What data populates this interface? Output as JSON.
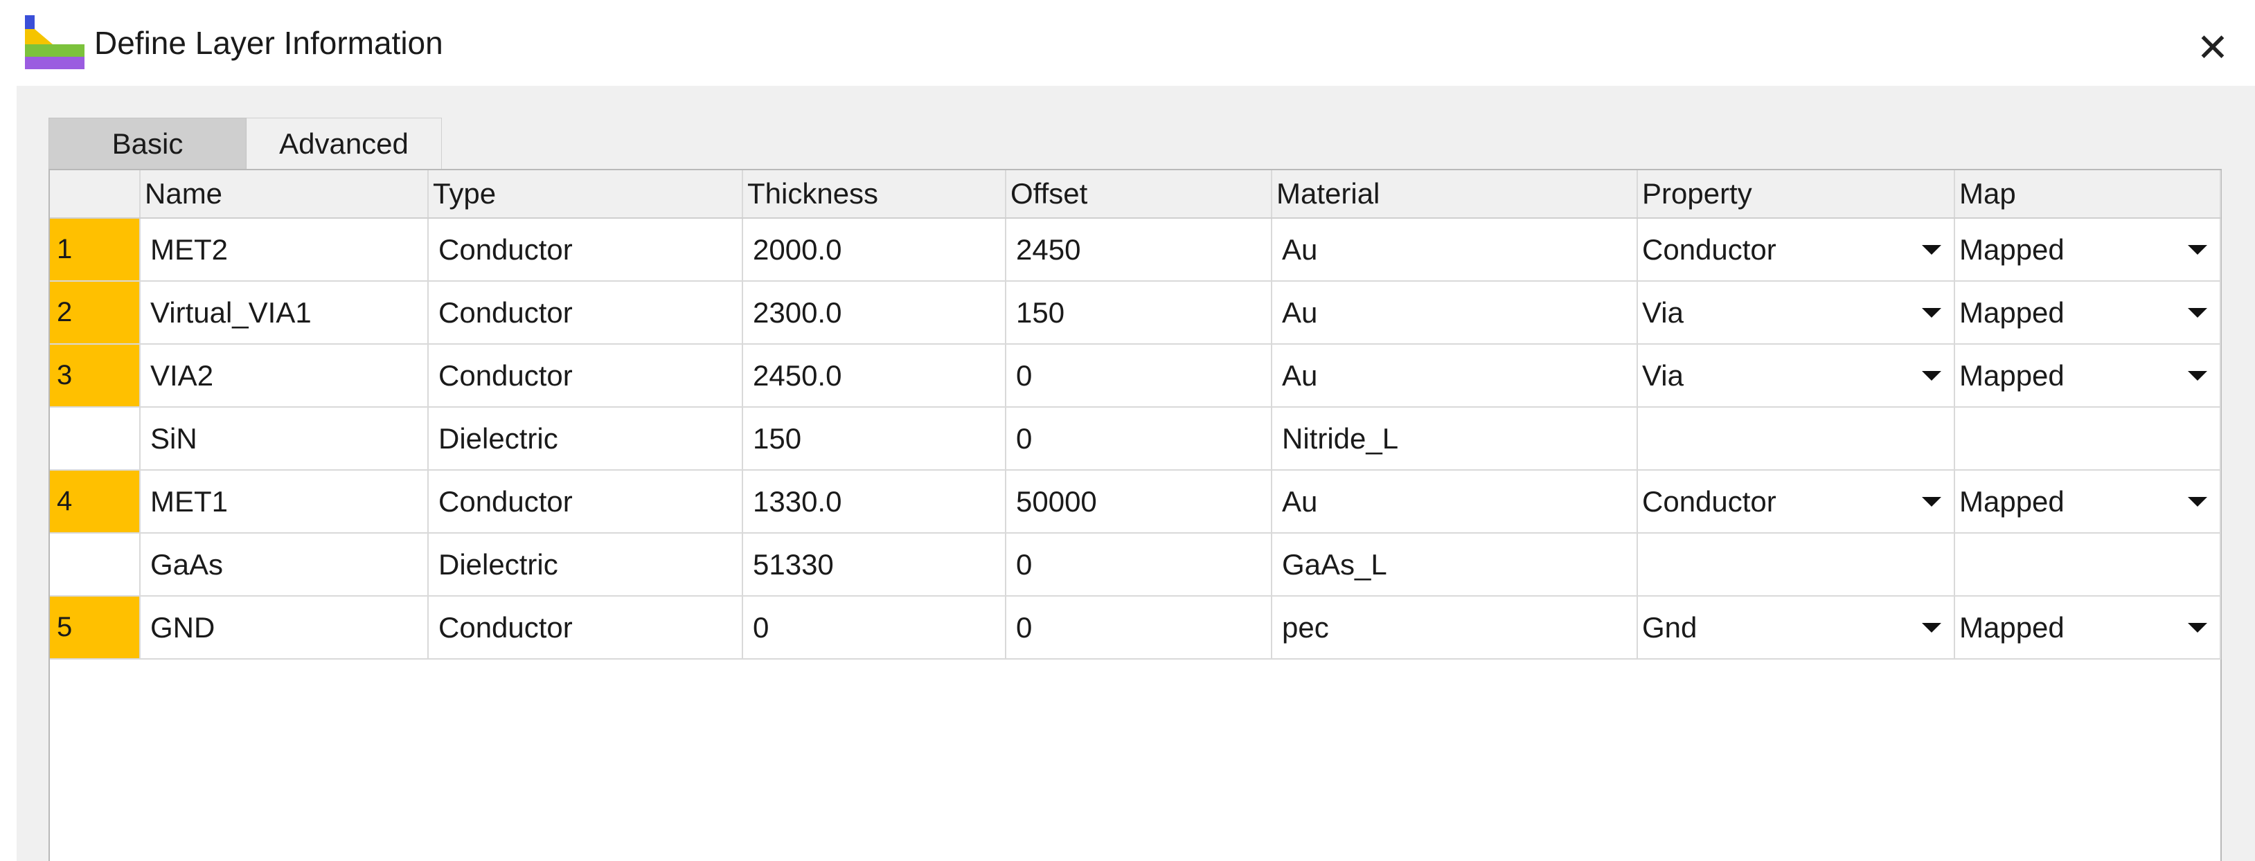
{
  "window": {
    "title": "Define Layer Information",
    "close_glyph": "✕",
    "app_icon": "layer-stack-icon",
    "icon_colors": [
      "#3a4fd8",
      "#f5c400",
      "#7cc23c",
      "#9b5ce0"
    ]
  },
  "tabs": [
    {
      "label": "Basic",
      "selected": true
    },
    {
      "label": "Advanced",
      "selected": false
    }
  ],
  "columns": [
    "Name",
    "Type",
    "Thickness",
    "Offset",
    "Material",
    "Property",
    "Map"
  ],
  "rows": [
    {
      "num": "1",
      "name": "MET2",
      "type": "Conductor",
      "thickness": "2000.0",
      "offset": "2450",
      "material": "Au",
      "property": "Conductor",
      "map": "Mapped"
    },
    {
      "num": "2",
      "name": "Virtual_VIA1",
      "type": "Conductor",
      "thickness": "2300.0",
      "offset": "150",
      "material": "Au",
      "property": "Via",
      "map": "Mapped"
    },
    {
      "num": "3",
      "name": "VIA2",
      "type": "Conductor",
      "thickness": "2450.0",
      "offset": "0",
      "material": "Au",
      "property": "Via",
      "map": "Mapped"
    },
    {
      "num": "",
      "name": "SiN",
      "type": "Dielectric",
      "thickness": "150",
      "offset": "0",
      "material": "Nitride_L",
      "property": "",
      "map": ""
    },
    {
      "num": "4",
      "name": "MET1",
      "type": "Conductor",
      "thickness": "1330.0",
      "offset": "50000",
      "material": "Au",
      "property": "Conductor",
      "map": "Mapped"
    },
    {
      "num": "",
      "name": "GaAs",
      "type": "Dielectric",
      "thickness": "51330",
      "offset": "0",
      "material": "GaAs_L",
      "property": "",
      "map": ""
    },
    {
      "num": "5",
      "name": "GND",
      "type": "Conductor",
      "thickness": "0",
      "offset": "0",
      "material": "pec",
      "property": "Gnd",
      "map": "Mapped"
    }
  ],
  "colors": {
    "row_number_highlight": "#ffc000",
    "panel_background": "#f0f0f0"
  }
}
